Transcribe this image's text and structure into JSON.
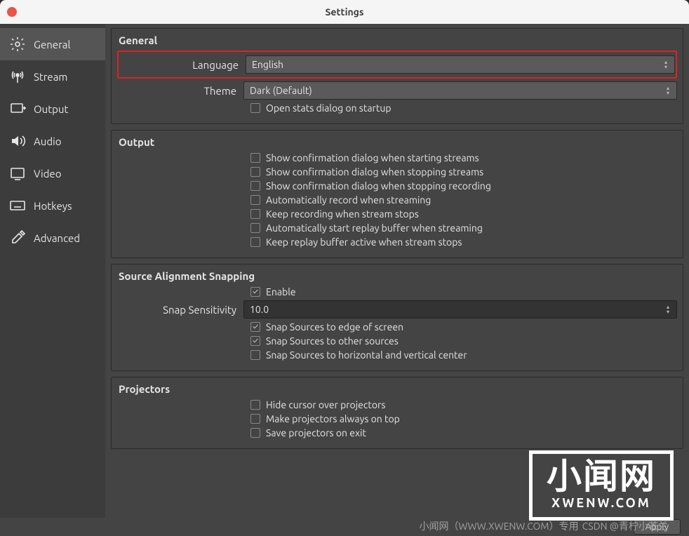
{
  "window": {
    "title": "Settings"
  },
  "sidebar": {
    "items": [
      {
        "label": "General"
      },
      {
        "label": "Stream"
      },
      {
        "label": "Output"
      },
      {
        "label": "Audio"
      },
      {
        "label": "Video"
      },
      {
        "label": "Hotkeys"
      },
      {
        "label": "Advanced"
      }
    ]
  },
  "general": {
    "title": "General",
    "language_label": "Language",
    "language_value": "English",
    "theme_label": "Theme",
    "theme_value": "Dark (Default)",
    "open_stats": "Open stats dialog on startup"
  },
  "output": {
    "title": "Output",
    "c1": "Show confirmation dialog when starting streams",
    "c2": "Show confirmation dialog when stopping streams",
    "c3": "Show confirmation dialog when stopping recording",
    "c4": "Automatically record when streaming",
    "c5": "Keep recording when stream stops",
    "c6": "Automatically start replay buffer when streaming",
    "c7": "Keep replay buffer active when stream stops"
  },
  "snap": {
    "title": "Source Alignment Snapping",
    "enable": "Enable",
    "sens_label": "Snap Sensitivity",
    "sens_value": "10.0",
    "edge": "Snap Sources to edge of screen",
    "other": "Snap Sources to other sources",
    "center": "Snap Sources to horizontal and vertical center"
  },
  "proj": {
    "title": "Projectors",
    "hide": "Hide cursor over projectors",
    "top": "Make projectors always on top",
    "save": "Save projectors on exit"
  },
  "buttons": {
    "apply": "Apply"
  },
  "watermark": {
    "cn": "小闻网",
    "en": "XWENW.COM",
    "small": "小闻网（WWW.XWENW.COM）专用",
    "csdn": "CSDN @青柠小苍兰"
  }
}
